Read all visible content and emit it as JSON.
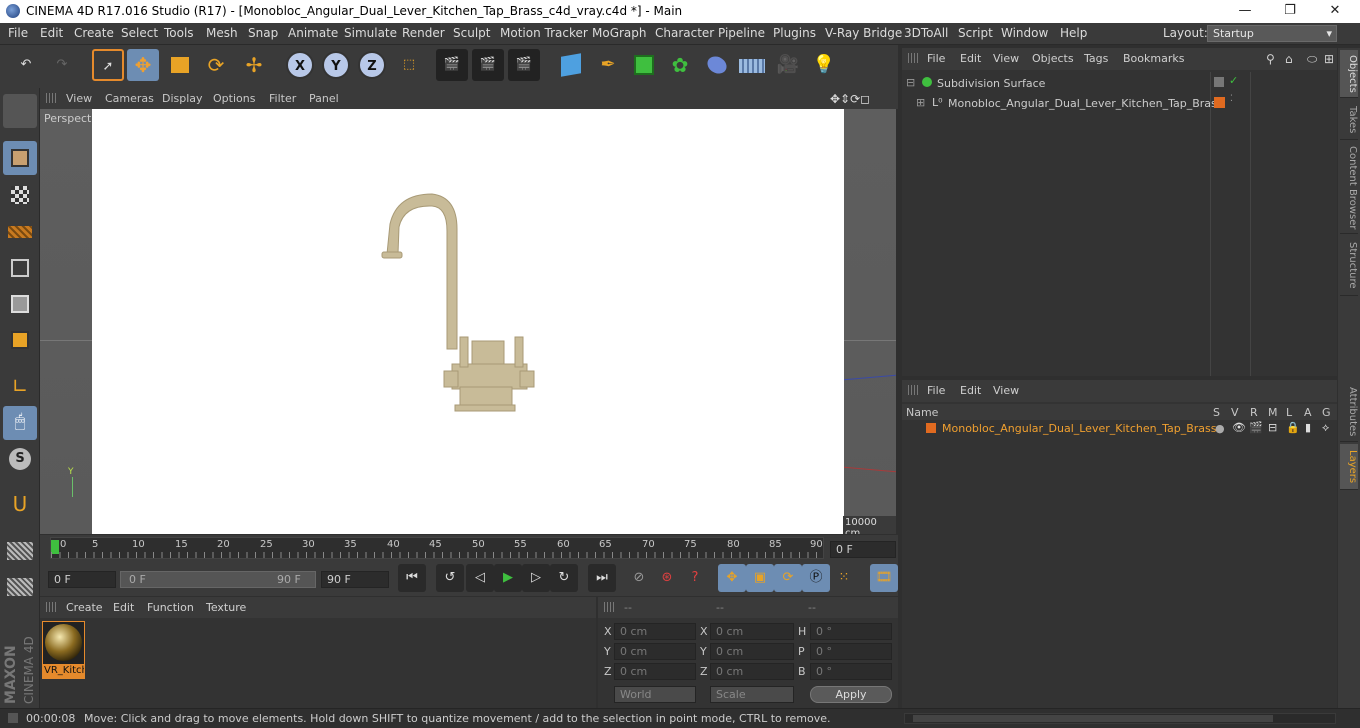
{
  "window": {
    "title": "CINEMA 4D R17.016 Studio (R17) - [Monobloc_Angular_Dual_Lever_Kitchen_Tap_Brass_c4d_vray.c4d *] - Main",
    "minimize": "—",
    "maximize": "❐",
    "close": "✕"
  },
  "menubar": {
    "items": [
      "File",
      "Edit",
      "Create",
      "Select",
      "Tools",
      "Mesh",
      "Snap",
      "Animate",
      "Simulate",
      "Render",
      "Sculpt",
      "Motion Tracker",
      "MoGraph",
      "Character",
      "Pipeline",
      "Plugins",
      "V-Ray Bridge",
      "3DToAll",
      "Script",
      "Window",
      "Help"
    ],
    "layout_label": "Layout:",
    "layout_value": "Startup"
  },
  "viewport": {
    "menu": [
      "View",
      "Cameras",
      "Display",
      "Options",
      "Filter",
      "Panel"
    ],
    "camera_label": "Perspective",
    "scale_label": "10000 cm",
    "axis_y": "Y"
  },
  "timeline": {
    "ticks": [
      "0",
      "5",
      "10",
      "15",
      "20",
      "25",
      "30",
      "35",
      "40",
      "45",
      "50",
      "55",
      "60",
      "65",
      "70",
      "75",
      "80",
      "85",
      "90"
    ],
    "current_frame": "0 F"
  },
  "transport": {
    "start_field": "0 F",
    "range_start": "0 F",
    "range_end": "90 F",
    "end_field": "90 F"
  },
  "material_panel": {
    "menu": [
      "Create",
      "Edit",
      "Function",
      "Texture"
    ],
    "material_label": "VR_Kitch"
  },
  "coord_panel": {
    "headers": [
      "--",
      "--",
      "--"
    ],
    "rows": [
      {
        "a_label": "X",
        "a_val": "0 cm",
        "b_label": "X",
        "b_val": "0 cm",
        "c_label": "H",
        "c_val": "0 °"
      },
      {
        "a_label": "Y",
        "a_val": "0 cm",
        "b_label": "Y",
        "b_val": "0 cm",
        "c_label": "P",
        "c_val": "0 °"
      },
      {
        "a_label": "Z",
        "a_val": "0 cm",
        "b_label": "Z",
        "b_val": "0 cm",
        "c_label": "B",
        "c_val": "0 °"
      }
    ],
    "world": "World",
    "scale": "Scale",
    "apply": "Apply"
  },
  "object_panel": {
    "menu": [
      "File",
      "Edit",
      "View",
      "Objects",
      "Tags",
      "Bookmarks"
    ],
    "objects": [
      {
        "name": "Subdivision Surface"
      },
      {
        "name": "Monobloc_Angular_Dual_Lever_Kitchen_Tap_Brass"
      }
    ]
  },
  "layer_panel": {
    "menu": [
      "File",
      "Edit",
      "View"
    ],
    "columns": [
      "Name",
      "S",
      "V",
      "R",
      "M",
      "L",
      "A",
      "G"
    ],
    "layer_name": "Monobloc_Angular_Dual_Lever_Kitchen_Tap_Brass"
  },
  "right_tabs": [
    "Objects",
    "Takes",
    "Content Browser",
    "Structure",
    "Attributes",
    "Layers"
  ],
  "status": {
    "time": "00:00:08",
    "message": "Move: Click and drag to move elements. Hold down SHIFT to quantize movement / add to the selection in point mode, CTRL to remove."
  },
  "brand": {
    "maxon": "MAXON",
    "c4d": "CINEMA 4D"
  },
  "colors": {
    "accent": "#6d8db3",
    "orange": "#e58a2c",
    "green": "#3fbf3f"
  }
}
